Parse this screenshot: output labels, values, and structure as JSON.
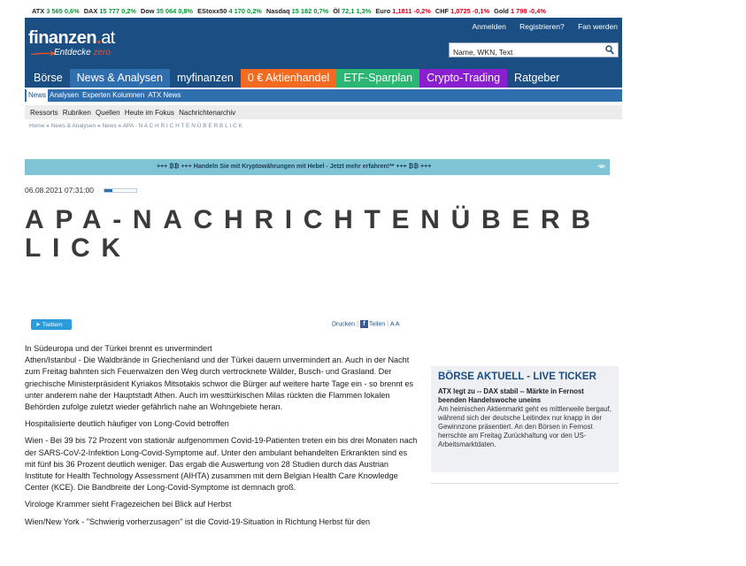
{
  "ticker": [
    {
      "name": "ATX",
      "value": "3 565",
      "change": "0,6%",
      "dir": "up"
    },
    {
      "name": "DAX",
      "value": "15 777",
      "change": "0,2%",
      "dir": "up"
    },
    {
      "name": "Dow",
      "value": "35 064",
      "change": "0,8%",
      "dir": "up"
    },
    {
      "name": "EStoxx50",
      "value": "4 170",
      "change": "0,2%",
      "dir": "up"
    },
    {
      "name": "Nasdaq",
      "value": "15 182",
      "change": "0,7%",
      "dir": "up"
    },
    {
      "name": "Öl",
      "value": "72,1",
      "change": "1,3%",
      "dir": "up"
    },
    {
      "name": "Euro",
      "value": "1,1811",
      "change": "-0,2%",
      "dir": "down"
    },
    {
      "name": "CHF",
      "value": "1,0725",
      "change": "-0,1%",
      "dir": "down"
    },
    {
      "name": "Gold",
      "value": "1 798",
      "change": "-0,4%",
      "dir": "down"
    }
  ],
  "header": {
    "logo_main": "finanzen",
    "logo_dot": ".",
    "logo_at": "at",
    "tagline": "Entdecke",
    "tagline_zero": "zero",
    "links": [
      "Anmelden",
      "Registrieren?",
      "Fan werden"
    ],
    "search_placeholder": "Name, WKN, Text"
  },
  "main_nav": [
    {
      "label": "Börse",
      "color": "#1b4e82"
    },
    {
      "label": "News & Analysen",
      "color": "#2f6fb0"
    },
    {
      "label": "myfinanzen",
      "color": "#1b4e82"
    },
    {
      "label": "0 € Aktienhandel",
      "color": "#f36b21"
    },
    {
      "label": "ETF-Sparplan",
      "color": "#2bb673"
    },
    {
      "label": "Crypto-Trading",
      "color": "#8a1fd0"
    },
    {
      "label": "Ratgeber",
      "color": "#1b4e82"
    }
  ],
  "sub_nav": [
    "News",
    "Analysen",
    "Experten Kolumnen",
    "ATX News"
  ],
  "secondary_nav": [
    "Ressorts",
    "Rubriken",
    "Quellen",
    "Heute im Fokus",
    "Nachrichtenarchiv"
  ],
  "breadcrumb": [
    "Home",
    "News & Analysen",
    "News",
    "APA - N A C H R I C H T E N Ü B E R B L I C K"
  ],
  "promo": {
    "text": "+++ ₿₿ +++ Handeln Sie mit Kryptowährungen mit Hebel - Jetzt mehr erfahren!** +++ ₿₿ +++",
    "more": "-w-"
  },
  "article": {
    "date": "06.08.2021 07:31:00",
    "reading_progress": 0.25,
    "title": "APA-NACHRICHTENÜBERBLICK",
    "share": {
      "twitter": "Twittern",
      "print": "Drucken",
      "facebook": "Teilen",
      "font": "A A"
    },
    "paragraphs": [
      "In Südeuropa und der Türkei brennt es unvermindert\nAthen/Istanbul - Die Waldbrände in Griechenland und der Türkei dauern unvermindert an. Auch in der Nacht zum Freitag bahnten sich Feuerwalzen den Weg durch vertrocknete Wälder, Busch- und Grasland. Der griechische Ministerpräsident Kyriakos Mitsotakis schwor die Bürger auf weitere harte Tage ein - so brennt es unter anderem nahe der Hauptstadt Athen. Auch im westtürkischen Milas rückten die Flammen lokalen Behörden zufolge zuletzt wieder gefährlich nahe an Wohngebiete heran.",
      "Hospitalisierte deutlich häufiger von Long-Covid betroffen",
      "Wien - Bei 39 bis 72 Prozent von stationär aufgenommen Covid-19-Patienten treten ein bis drei Monaten nach der SARS-CoV-2-Infektion Long-Covid-Symptome auf. Unter den ambulant behandelten Erkrankten sind es mit fünf bis 36 Prozent deutlich weniger. Das ergab die Auswertung von 28 Studien durch das Austrian Institute for Health Technology Assessment (AIHTA) zusammen mit dem Belgian Health Care Knowledge Center (KCE). Die Bandbreite der Long-Covid-Symptome ist demnach groß.",
      "Virologe Krammer sieht Fragezeichen bei Blick auf Herbst",
      "Wien/New York - \"Schwierig vorherzusagen\" ist die Covid-19-Situation in Richtung Herbst für den"
    ]
  },
  "sidebar": {
    "heading": "BÖRSE AKTUELL - LIVE TICKER",
    "subheading": "ATX legt zu -- DAX stabil -- Märkte in Fernost beenden Handelswoche uneins",
    "body": "Am heimischen Aktienmarkt geht es mittlerweile bergauf, während sich der deutsche Leitindex nur knapp in der Gewinnzone präsentiert. An den Börsen in Fernost herrschte am Freitag Zurückhaltung vor den US-Arbeitsmarktdaten."
  }
}
